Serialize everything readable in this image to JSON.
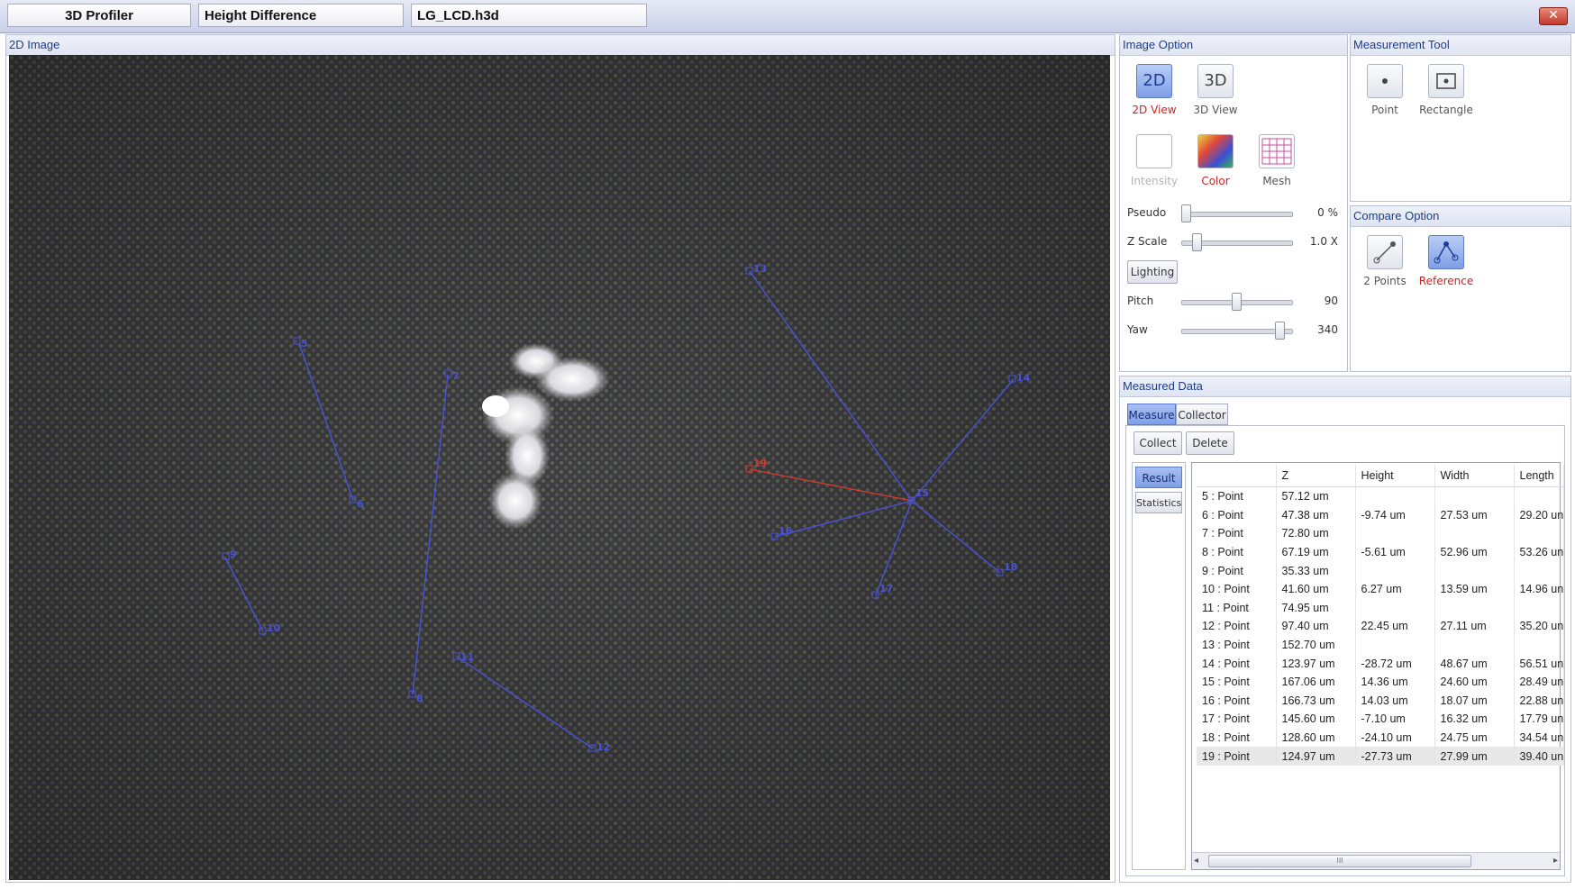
{
  "titlebar": {
    "boxes": [
      "3D Profiler",
      "Height Difference",
      "LG_LCD.h3d"
    ],
    "close_glyph": "✕"
  },
  "image_panel": {
    "header": "2D Image",
    "markers": [
      {
        "label": "5"
      },
      {
        "label": "6"
      },
      {
        "label": "7"
      },
      {
        "label": "8"
      },
      {
        "label": "9"
      },
      {
        "label": "10"
      },
      {
        "label": "11"
      },
      {
        "label": "12"
      },
      {
        "label": "13"
      },
      {
        "label": "14"
      },
      {
        "label": "15"
      },
      {
        "label": "16"
      },
      {
        "label": "17"
      },
      {
        "label": "18"
      },
      {
        "label": "19"
      }
    ]
  },
  "image_option": {
    "header": "Image Option",
    "view_2d": {
      "icon_text": "2D",
      "label": "2D View"
    },
    "view_3d": {
      "icon_text": "3D",
      "label": "3D View"
    },
    "intensity_label": "Intensity",
    "color_label": "Color",
    "mesh_label": "Mesh",
    "pseudo": {
      "label": "Pseudo",
      "value": "0 %",
      "level": 0.0
    },
    "zscale": {
      "label": "Z Scale",
      "value": "1.0 X",
      "level": 0.1
    },
    "lighting_label": "Lighting",
    "pitch": {
      "label": "Pitch",
      "value": "90",
      "level": 0.5
    },
    "yaw": {
      "label": "Yaw",
      "value": "340",
      "level": 0.94
    }
  },
  "measurement_tool": {
    "header": "Measurement Tool",
    "point_label": "Point",
    "rectangle_label": "Rectangle"
  },
  "compare_option": {
    "header": "Compare Option",
    "two_points_label": "2 Points",
    "reference_label": "Reference"
  },
  "measured_data": {
    "header": "Measured Data",
    "tabs": [
      "Measure",
      "Collector"
    ],
    "collect_label": "Collect",
    "delete_label": "Delete",
    "side_tabs": [
      "Result",
      "Statistics"
    ],
    "columns": [
      "",
      "Z",
      "Height",
      "Width",
      "Length"
    ],
    "rows": [
      [
        "5 : Point",
        "57.12 um",
        "",
        "",
        ""
      ],
      [
        "6 : Point",
        "47.38 um",
        "-9.74 um",
        "27.53 um",
        "29.20 un"
      ],
      [
        "7 : Point",
        "72.80 um",
        "",
        "",
        ""
      ],
      [
        "8 : Point",
        "67.19 um",
        "-5.61 um",
        "52.96 um",
        "53.26 un"
      ],
      [
        "9 : Point",
        "35.33 um",
        "",
        "",
        ""
      ],
      [
        "10 : Point",
        "41.60 um",
        "6.27 um",
        "13.59 um",
        "14.96 un"
      ],
      [
        "11 : Point",
        "74.95 um",
        "",
        "",
        ""
      ],
      [
        "12 : Point",
        "97.40 um",
        "22.45 um",
        "27.11 um",
        "35.20 un"
      ],
      [
        "13 : Point",
        "152.70 um",
        "",
        "",
        ""
      ],
      [
        "14 : Point",
        "123.97 um",
        "-28.72 um",
        "48.67 um",
        "56.51 un"
      ],
      [
        "15 : Point",
        "167.06 um",
        "14.36 um",
        "24.60 um",
        "28.49 un"
      ],
      [
        "16 : Point",
        "166.73 um",
        "14.03 um",
        "18.07 um",
        "22.88 un"
      ],
      [
        "17 : Point",
        "145.60 um",
        "-7.10 um",
        "16.32 um",
        "17.79 un"
      ],
      [
        "18 : Point",
        "128.60 um",
        "-24.10 um",
        "24.75 um",
        "34.54 un"
      ],
      [
        "19 : Point",
        "124.97 um",
        "-27.73 um",
        "27.99 um",
        "39.40 un"
      ]
    ],
    "scroll_glyph": "III"
  },
  "colors": {
    "accent": "#1a3d8c",
    "marker_blue": "#4a52d6",
    "marker_red": "#d83a2e",
    "selected_label": "#d11f1f"
  }
}
